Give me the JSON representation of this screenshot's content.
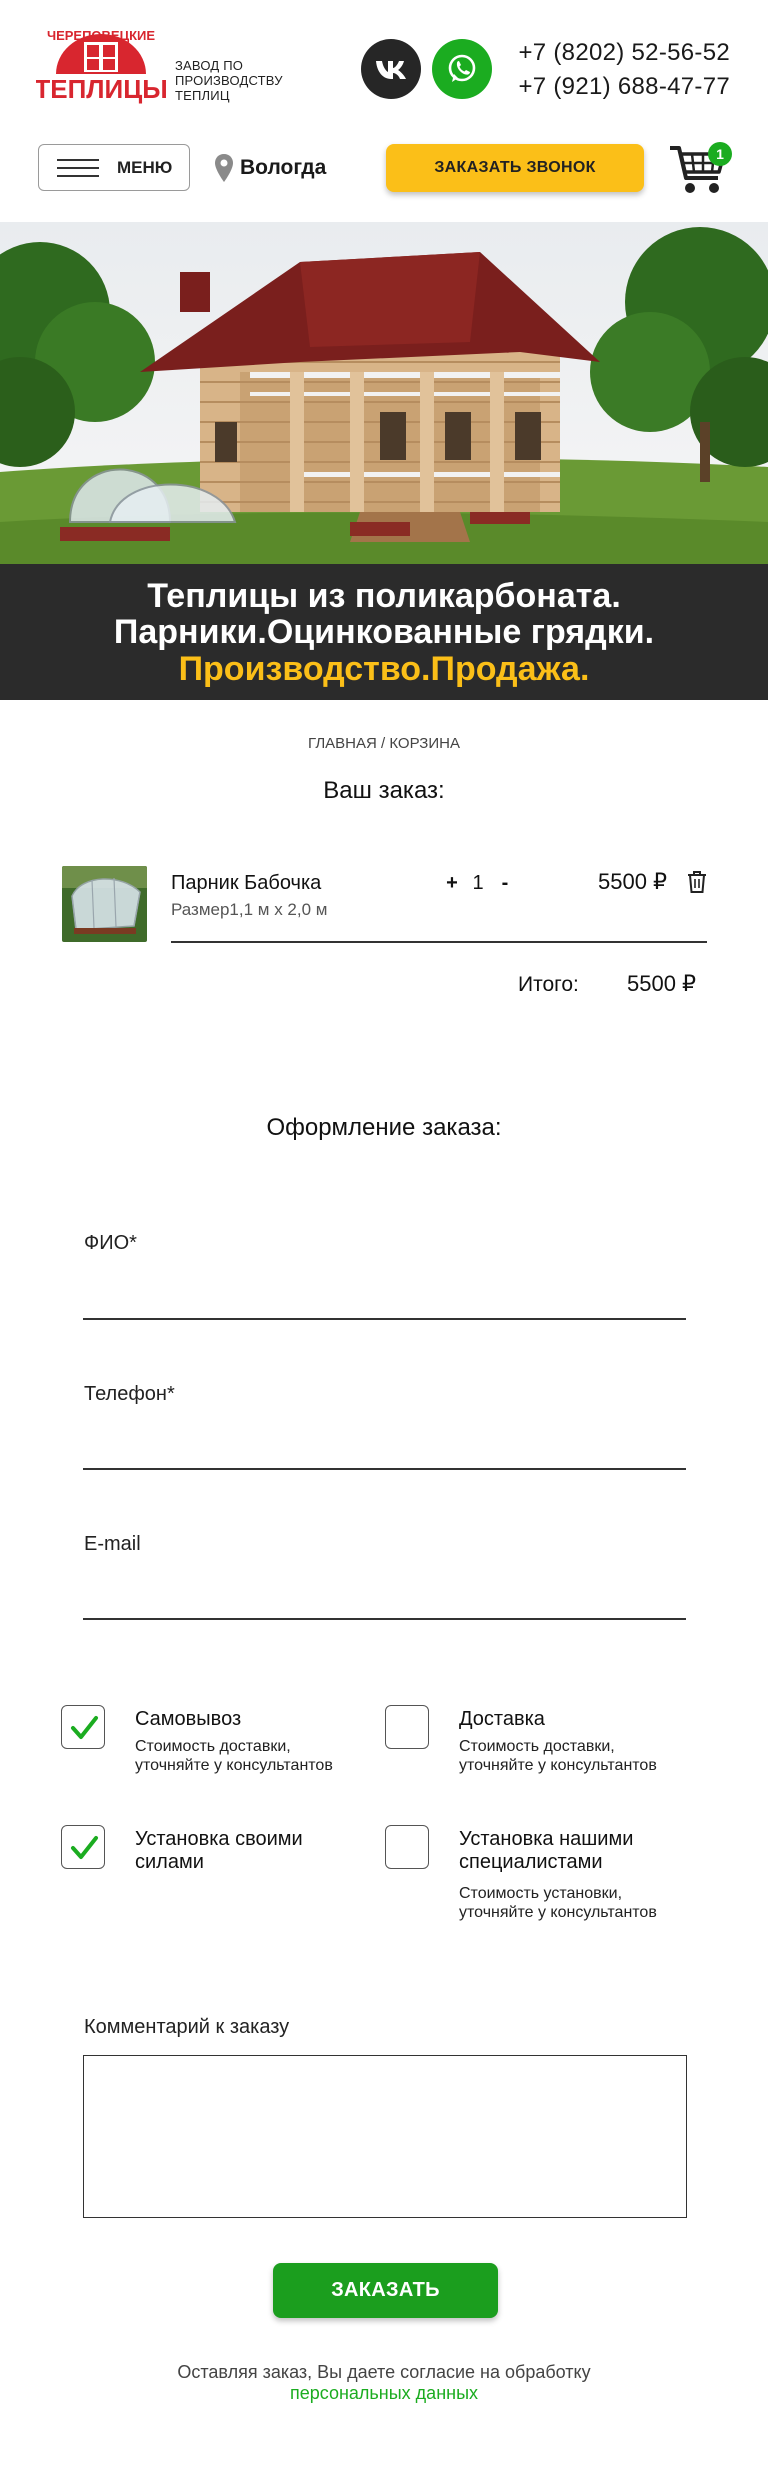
{
  "header": {
    "logo_line1": "ЧЕРЕПОВЕЦКИЕ",
    "logo_line2": "ТЕПЛИЦЫ",
    "tagline": "Завод по производству теплиц",
    "phones": [
      "+7 (8202) 52-56-52",
      "+7 (921) 688-47-77"
    ],
    "menu_label": "МЕНЮ",
    "city": "Вологда",
    "call_button": "ЗАКАЗАТЬ ЗВОНОК",
    "cart_count": "1"
  },
  "hero": {
    "line1": "Теплицы из поликарбоната.",
    "line2": "Парники.Оцинкованные грядки.",
    "line3": "Производство.Продажа."
  },
  "cart": {
    "breadcrumb": "ГЛАВНАЯ / КОРЗИНА",
    "title": "Ваш заказ:",
    "item": {
      "name": "Парник Бабочка",
      "size": "Размер1,1 м х 2,0 м",
      "plus": "+",
      "qty": "1",
      "minus": "-",
      "price": "5500 ₽"
    },
    "total_label": "Итого:",
    "total_value": "5500 ₽"
  },
  "checkout": {
    "title": "Оформление заказа:",
    "fields": {
      "name_label": "ФИО*",
      "phone_label": "Телефон*",
      "email_label": "E-mail"
    },
    "options": {
      "pickup": {
        "title": "Самовывоз",
        "note_line1": "Стоимость доставки,",
        "note_line2": "уточняйте у консультантов",
        "checked": true
      },
      "delivery": {
        "title": "Доставка",
        "note_line1": "Стоимость доставки,",
        "note_line2": "уточняйте у консультантов",
        "checked": false
      },
      "self_install": {
        "title_line1": "Установка своими",
        "title_line2": "силами",
        "checked": true
      },
      "pro_install": {
        "title_line1": "Установка нашими",
        "title_line2": "специалистами",
        "note_line1": "Стоимость установки,",
        "note_line2": "уточняйте у консультантов",
        "checked": false
      }
    },
    "comment_label": "Комментарий к заказу",
    "submit": "ЗАКАЗАТЬ",
    "consent_text": "Оставляя заказ, Вы даете согласие на обработку",
    "consent_link": "персональных данных"
  },
  "colors": {
    "brand_red": "#d8262f",
    "accent_yellow": "#fbbf18",
    "accent_green": "#1bac20",
    "dark_band": "#2b2b2b"
  },
  "icons": [
    "vk-icon",
    "whatsapp-icon",
    "location-pin-icon",
    "cart-icon",
    "trash-icon",
    "checkmark-icon",
    "burger-icon"
  ]
}
